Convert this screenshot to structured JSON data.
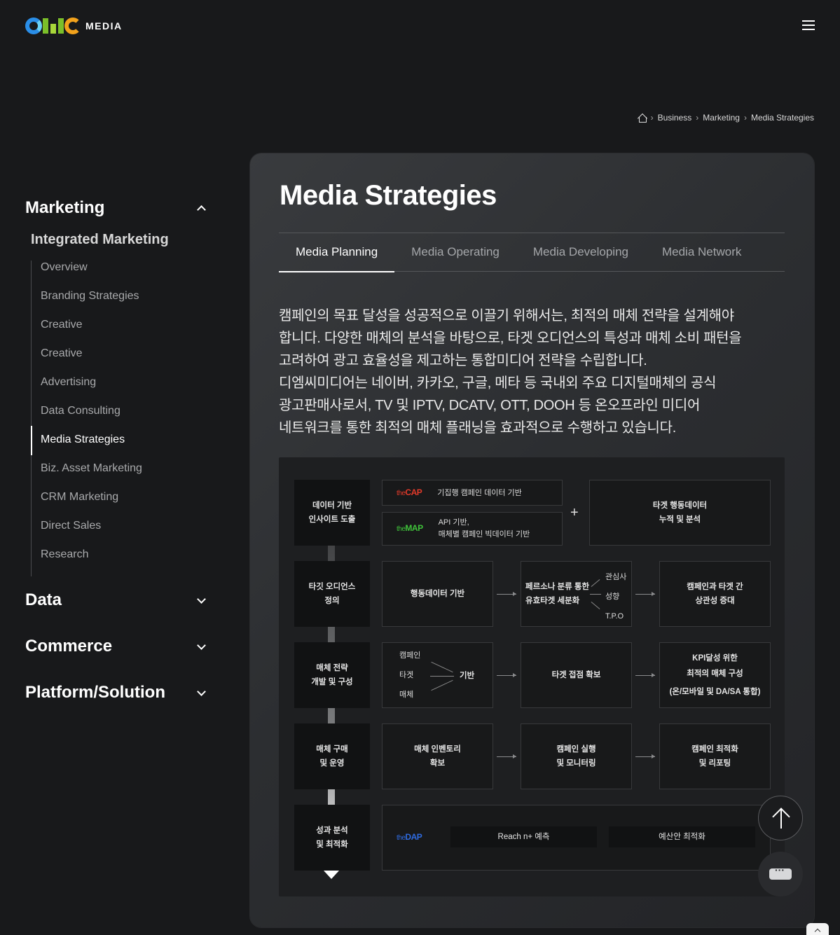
{
  "header": {
    "logo_text": "MEDIA"
  },
  "breadcrumb": [
    "Business",
    "Marketing",
    "Media Strategies"
  ],
  "sidebar": {
    "categories": [
      {
        "label": "Marketing",
        "expanded": true
      },
      {
        "label": "Data"
      },
      {
        "label": "Commerce"
      },
      {
        "label": "Platform/Solution"
      }
    ],
    "subcategory": "Integrated Marketing",
    "items": [
      "Overview",
      "Branding Strategies",
      "Creative",
      "Creative",
      "Advertising",
      "Data Consulting",
      "Media Strategies",
      "Biz. Asset Marketing",
      "CRM Marketing",
      "Direct Sales",
      "Research"
    ],
    "active_item": "Media Strategies"
  },
  "main": {
    "title": "Media Strategies",
    "tabs": [
      "Media Planning",
      "Media Operating",
      "Media Developing",
      "Media Network"
    ],
    "active_tab": "Media Planning",
    "description": [
      "캠페인의 목표 달성을 성공적으로 이끌기 위해서는, 최적의 매체 전략을 설계해야",
      "합니다. 다양한 매체의 분석을 바탕으로, 타겟 오디언스의 특성과 매체 소비 패턴을",
      "고려하여 광고 효율성을 제고하는 통합미디어 전략을 수립합니다.",
      "디엠씨미디어는 네이버, 카카오, 구글, 메타 등 국내외 주요 디지털매체의 공식",
      "광고판매사로서, TV 및 IPTV, DCATV, OTT, DOOH 등 온오프라인 미디어",
      "네트워크를 통한 최적의 매체 플래닝을 효과적으로 수행하고 있습니다."
    ]
  },
  "diagram": {
    "stages": [
      [
        "데이터 기반",
        "인사이트 도출"
      ],
      [
        "타깃 오디언스",
        "정의"
      ],
      [
        "매체 전략",
        "개발 및 구성"
      ],
      [
        "매체 구매",
        "및 운영"
      ],
      [
        "성과 분석",
        "및 최적화"
      ]
    ],
    "row1": {
      "cap_brand_the": "the",
      "cap_brand": "CAP",
      "cap_desc": "기집행 캠페인 데이터 기반",
      "map_brand_the": "the",
      "map_brand": "MAP",
      "map_desc": [
        "API 기반,",
        "매체별 캠페인 빅데이터 기반"
      ],
      "plus": "+",
      "result": [
        "타겟 행동데이터",
        "누적 및 분석"
      ]
    },
    "row2": {
      "b1": "행동데이터 기반",
      "b2": [
        "페르소나 분류 통한",
        "유효타겟 세분화"
      ],
      "b2_tags": [
        "관심사",
        "성향",
        "T.P.O"
      ],
      "b3": [
        "캠페인과 타겟 간",
        "상관성 증대"
      ]
    },
    "row3": {
      "b1_tags": [
        "캠페인",
        "타겟",
        "매체"
      ],
      "b1_result": "기반",
      "b2": "타겟 접점 확보",
      "b3": [
        "KPI달성 위한",
        "최적의 매체 구성",
        "(온/모바일 및 DA/SA 통합)"
      ]
    },
    "row4": {
      "b1": [
        "매체 인벤토리",
        "확보"
      ],
      "b2": [
        "캠페인 실행",
        "및 모니터링"
      ],
      "b3": [
        "캠페인 최적화",
        "및 리포팅"
      ]
    },
    "row5": {
      "dap_brand_the": "the",
      "dap_brand": "DAP",
      "chip1": "Reach n+ 예측",
      "chip2": "예산안 최적화"
    }
  },
  "colors": {
    "cap": "#e23a2a",
    "map": "#3fc23a",
    "dap": "#2f6be0"
  },
  "icons": [
    "home-icon",
    "menu-icon",
    "chevron-up-icon",
    "chevron-down-icon",
    "arrow-up-icon",
    "chat-icon"
  ]
}
